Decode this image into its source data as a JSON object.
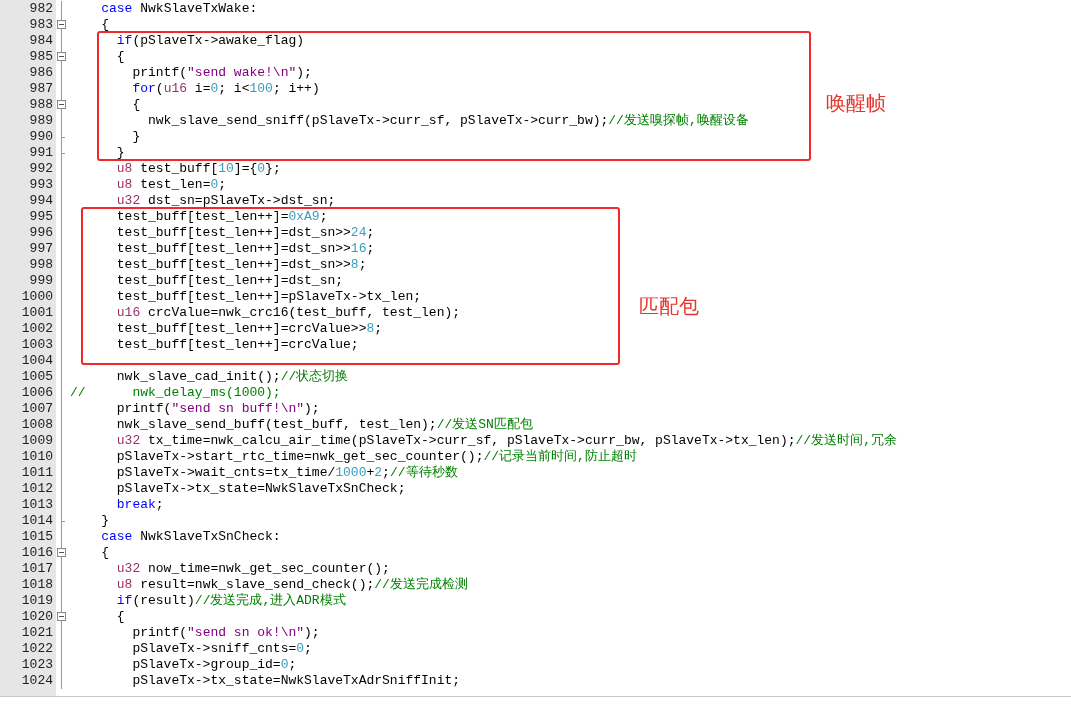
{
  "editor": {
    "lines": [
      {
        "number": "982",
        "fold_box": false,
        "fold_end": false,
        "tokens": [
          {
            "kind": "keyword",
            "text": "    case"
          },
          {
            "kind": "plain",
            "text": " NwkSlaveTxWake:"
          }
        ]
      },
      {
        "number": "983",
        "fold_box": true,
        "fold_end": false,
        "tokens": [
          {
            "kind": "plain",
            "text": "    {"
          }
        ]
      },
      {
        "number": "984",
        "fold_box": false,
        "fold_end": false,
        "tokens": [
          {
            "kind": "keyword",
            "text": "      if"
          },
          {
            "kind": "plain",
            "text": "(pSlaveTx->awake_flag)"
          }
        ]
      },
      {
        "number": "985",
        "fold_box": true,
        "fold_end": false,
        "tokens": [
          {
            "kind": "plain",
            "text": "      {"
          }
        ]
      },
      {
        "number": "986",
        "fold_box": false,
        "fold_end": false,
        "tokens": [
          {
            "kind": "plain",
            "text": "        printf("
          },
          {
            "kind": "string",
            "text": "\"send wake!\\n\""
          },
          {
            "kind": "plain",
            "text": ");"
          }
        ]
      },
      {
        "number": "987",
        "fold_box": false,
        "fold_end": false,
        "tokens": [
          {
            "kind": "keyword",
            "text": "        for"
          },
          {
            "kind": "plain",
            "text": "("
          },
          {
            "kind": "type",
            "text": "u16"
          },
          {
            "kind": "plain",
            "text": " i="
          },
          {
            "kind": "number",
            "text": "0"
          },
          {
            "kind": "plain",
            "text": "; i<"
          },
          {
            "kind": "number",
            "text": "100"
          },
          {
            "kind": "plain",
            "text": "; i++)"
          }
        ]
      },
      {
        "number": "988",
        "fold_box": true,
        "fold_end": false,
        "tokens": [
          {
            "kind": "plain",
            "text": "        {"
          }
        ]
      },
      {
        "number": "989",
        "fold_box": false,
        "fold_end": false,
        "tokens": [
          {
            "kind": "plain",
            "text": "          nwk_slave_send_sniff(pSlaveTx->curr_sf, pSlaveTx->curr_bw);"
          },
          {
            "kind": "comment",
            "text": "//发送嗅探帧,唤醒设备"
          }
        ]
      },
      {
        "number": "990",
        "fold_box": false,
        "fold_end": true,
        "tokens": [
          {
            "kind": "plain",
            "text": "        }"
          }
        ]
      },
      {
        "number": "991",
        "fold_box": false,
        "fold_end": true,
        "tokens": [
          {
            "kind": "plain",
            "text": "      }"
          }
        ]
      },
      {
        "number": "992",
        "fold_box": false,
        "fold_end": false,
        "tokens": [
          {
            "kind": "type",
            "text": "      u8"
          },
          {
            "kind": "plain",
            "text": " test_buff["
          },
          {
            "kind": "number",
            "text": "10"
          },
          {
            "kind": "plain",
            "text": "]={"
          },
          {
            "kind": "number",
            "text": "0"
          },
          {
            "kind": "plain",
            "text": "};"
          }
        ]
      },
      {
        "number": "993",
        "fold_box": false,
        "fold_end": false,
        "tokens": [
          {
            "kind": "type",
            "text": "      u8"
          },
          {
            "kind": "plain",
            "text": " test_len="
          },
          {
            "kind": "number",
            "text": "0"
          },
          {
            "kind": "plain",
            "text": ";"
          }
        ]
      },
      {
        "number": "994",
        "fold_box": false,
        "fold_end": false,
        "tokens": [
          {
            "kind": "type",
            "text": "      u32"
          },
          {
            "kind": "plain",
            "text": " dst_sn=pSlaveTx->dst_sn;"
          }
        ]
      },
      {
        "number": "995",
        "fold_box": false,
        "fold_end": false,
        "tokens": [
          {
            "kind": "plain",
            "text": "      test_buff[test_len++]="
          },
          {
            "kind": "number",
            "text": "0xA9"
          },
          {
            "kind": "plain",
            "text": ";"
          }
        ]
      },
      {
        "number": "996",
        "fold_box": false,
        "fold_end": false,
        "tokens": [
          {
            "kind": "plain",
            "text": "      test_buff[test_len++]=dst_sn>>"
          },
          {
            "kind": "number",
            "text": "24"
          },
          {
            "kind": "plain",
            "text": ";"
          }
        ]
      },
      {
        "number": "997",
        "fold_box": false,
        "fold_end": false,
        "tokens": [
          {
            "kind": "plain",
            "text": "      test_buff[test_len++]=dst_sn>>"
          },
          {
            "kind": "number",
            "text": "16"
          },
          {
            "kind": "plain",
            "text": ";"
          }
        ]
      },
      {
        "number": "998",
        "fold_box": false,
        "fold_end": false,
        "tokens": [
          {
            "kind": "plain",
            "text": "      test_buff[test_len++]=dst_sn>>"
          },
          {
            "kind": "number",
            "text": "8"
          },
          {
            "kind": "plain",
            "text": ";"
          }
        ]
      },
      {
        "number": "999",
        "fold_box": false,
        "fold_end": false,
        "tokens": [
          {
            "kind": "plain",
            "text": "      test_buff[test_len++]=dst_sn;"
          }
        ]
      },
      {
        "number": "1000",
        "fold_box": false,
        "fold_end": false,
        "tokens": [
          {
            "kind": "plain",
            "text": "      test_buff[test_len++]=pSlaveTx->tx_len;"
          }
        ]
      },
      {
        "number": "1001",
        "fold_box": false,
        "fold_end": false,
        "tokens": [
          {
            "kind": "type",
            "text": "      u16"
          },
          {
            "kind": "plain",
            "text": " crcValue=nwk_crc16(test_buff, test_len);"
          }
        ]
      },
      {
        "number": "1002",
        "fold_box": false,
        "fold_end": false,
        "tokens": [
          {
            "kind": "plain",
            "text": "      test_buff[test_len++]=crcValue>>"
          },
          {
            "kind": "number",
            "text": "8"
          },
          {
            "kind": "plain",
            "text": ";"
          }
        ]
      },
      {
        "number": "1003",
        "fold_box": false,
        "fold_end": false,
        "tokens": [
          {
            "kind": "plain",
            "text": "      test_buff[test_len++]=crcValue;"
          }
        ]
      },
      {
        "number": "1004",
        "fold_box": false,
        "fold_end": false
      },
      {
        "number": "1005",
        "fold_box": false,
        "fold_end": false,
        "tokens": [
          {
            "kind": "plain",
            "text": "      nwk_slave_cad_init();"
          },
          {
            "kind": "comment",
            "text": "//状态切换"
          }
        ]
      },
      {
        "number": "1006",
        "fold_box": false,
        "fold_end": false,
        "tokens": [
          {
            "kind": "comment",
            "text": "//      nwk_delay_ms(1000);"
          }
        ]
      },
      {
        "number": "1007",
        "fold_box": false,
        "fold_end": false,
        "tokens": [
          {
            "kind": "plain",
            "text": "      printf("
          },
          {
            "kind": "string",
            "text": "\"send sn buff!\\n\""
          },
          {
            "kind": "plain",
            "text": ");"
          }
        ]
      },
      {
        "number": "1008",
        "fold_box": false,
        "fold_end": false,
        "tokens": [
          {
            "kind": "plain",
            "text": "      nwk_slave_send_buff(test_buff, test_len);"
          },
          {
            "kind": "comment",
            "text": "//发送SN匹配包"
          }
        ]
      },
      {
        "number": "1009",
        "fold_box": false,
        "fold_end": false,
        "tokens": [
          {
            "kind": "type",
            "text": "      u32"
          },
          {
            "kind": "plain",
            "text": " tx_time=nwk_calcu_air_time(pSlaveTx->curr_sf, pSlaveTx->curr_bw, pSlaveTx->tx_len);"
          },
          {
            "kind": "comment",
            "text": "//发送时间,冗余"
          }
        ]
      },
      {
        "number": "1010",
        "fold_box": false,
        "fold_end": false,
        "tokens": [
          {
            "kind": "plain",
            "text": "      pSlaveTx->start_rtc_time=nwk_get_sec_counter();"
          },
          {
            "kind": "comment",
            "text": "//记录当前时间,防止超时"
          }
        ]
      },
      {
        "number": "1011",
        "fold_box": false,
        "fold_end": false,
        "tokens": [
          {
            "kind": "plain",
            "text": "      pSlaveTx->wait_cnts=tx_time/"
          },
          {
            "kind": "number",
            "text": "1000"
          },
          {
            "kind": "plain",
            "text": "+"
          },
          {
            "kind": "number",
            "text": "2"
          },
          {
            "kind": "plain",
            "text": ";"
          },
          {
            "kind": "comment",
            "text": "//等待秒数"
          }
        ]
      },
      {
        "number": "1012",
        "fold_box": false,
        "fold_end": false,
        "tokens": [
          {
            "kind": "plain",
            "text": "      pSlaveTx->tx_state=NwkSlaveTxSnCheck;"
          }
        ]
      },
      {
        "number": "1013",
        "fold_box": false,
        "fold_end": false,
        "tokens": [
          {
            "kind": "keyword",
            "text": "      break"
          },
          {
            "kind": "plain",
            "text": ";"
          }
        ]
      },
      {
        "number": "1014",
        "fold_box": false,
        "fold_end": true,
        "tokens": [
          {
            "kind": "plain",
            "text": "    }"
          }
        ]
      },
      {
        "number": "1015",
        "fold_box": false,
        "fold_end": false,
        "tokens": [
          {
            "kind": "keyword",
            "text": "    case"
          },
          {
            "kind": "plain",
            "text": " NwkSlaveTxSnCheck:"
          }
        ]
      },
      {
        "number": "1016",
        "fold_box": true,
        "fold_end": false,
        "tokens": [
          {
            "kind": "plain",
            "text": "    {"
          }
        ]
      },
      {
        "number": "1017",
        "fold_box": false,
        "fold_end": false,
        "tokens": [
          {
            "kind": "type",
            "text": "      u32"
          },
          {
            "kind": "plain",
            "text": " now_time=nwk_get_sec_counter();"
          }
        ]
      },
      {
        "number": "1018",
        "fold_box": false,
        "fold_end": false,
        "tokens": [
          {
            "kind": "type",
            "text": "      u8"
          },
          {
            "kind": "plain",
            "text": " result=nwk_slave_send_check();"
          },
          {
            "kind": "comment",
            "text": "//发送完成检测"
          }
        ]
      },
      {
        "number": "1019",
        "fold_box": false,
        "fold_end": false,
        "tokens": [
          {
            "kind": "keyword",
            "text": "      if"
          },
          {
            "kind": "plain",
            "text": "(result)"
          },
          {
            "kind": "comment",
            "text": "//发送完成,进入ADR模式"
          }
        ]
      },
      {
        "number": "1020",
        "fold_box": true,
        "fold_end": false,
        "tokens": [
          {
            "kind": "plain",
            "text": "      {"
          }
        ]
      },
      {
        "number": "1021",
        "fold_box": false,
        "fold_end": false,
        "tokens": [
          {
            "kind": "plain",
            "text": "        printf("
          },
          {
            "kind": "string",
            "text": "\"send sn ok!\\n\""
          },
          {
            "kind": "plain",
            "text": ");"
          }
        ]
      },
      {
        "number": "1022",
        "fold_box": false,
        "fold_end": false,
        "tokens": [
          {
            "kind": "plain",
            "text": "        pSlaveTx->sniff_cnts="
          },
          {
            "kind": "number",
            "text": "0"
          },
          {
            "kind": "plain",
            "text": ";"
          }
        ]
      },
      {
        "number": "1023",
        "fold_box": false,
        "fold_end": false,
        "tokens": [
          {
            "kind": "plain",
            "text": "        pSlaveTx->group_id="
          },
          {
            "kind": "number",
            "text": "0"
          },
          {
            "kind": "plain",
            "text": ";"
          }
        ]
      },
      {
        "number": "1024",
        "fold_box": false,
        "fold_end": false,
        "tokens": [
          {
            "kind": "plain",
            "text": "        pSlaveTx->tx_state=NwkSlaveTxAdrSniffInit;"
          }
        ]
      }
    ]
  },
  "annotations": [
    {
      "label": "唤醒帧"
    },
    {
      "label": "匹配包"
    }
  ]
}
